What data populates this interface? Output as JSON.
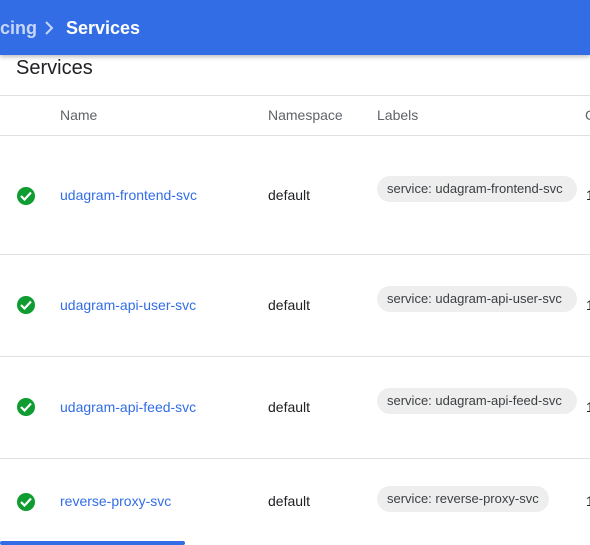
{
  "breadcrumb": {
    "previous": "cing",
    "current": "Services"
  },
  "card": {
    "title": "Services"
  },
  "table": {
    "columns": [
      "Name",
      "Namespace",
      "Labels",
      "C"
    ],
    "rows": [
      {
        "status": "ok",
        "name": "udagram-frontend-svc",
        "namespace": "default",
        "label": "service: udagram-frontend-svc",
        "cut": "1"
      },
      {
        "status": "ok",
        "name": "udagram-api-user-svc",
        "namespace": "default",
        "label": "service: udagram-api-user-svc",
        "cut": "1"
      },
      {
        "status": "ok",
        "name": "udagram-api-feed-svc",
        "namespace": "default",
        "label": "service: udagram-api-feed-svc",
        "cut": "1"
      },
      {
        "status": "ok",
        "name": "reverse-proxy-svc",
        "namespace": "default",
        "label": "service: reverse-proxy-svc",
        "cut": "1"
      }
    ]
  },
  "colors": {
    "header_bg": "#326de6",
    "link": "#326de6",
    "status_ok": "#0f9d31"
  },
  "icons": {
    "breadcrumb_separator": "chevron-right-icon",
    "status_ok": "check-circle-icon"
  }
}
